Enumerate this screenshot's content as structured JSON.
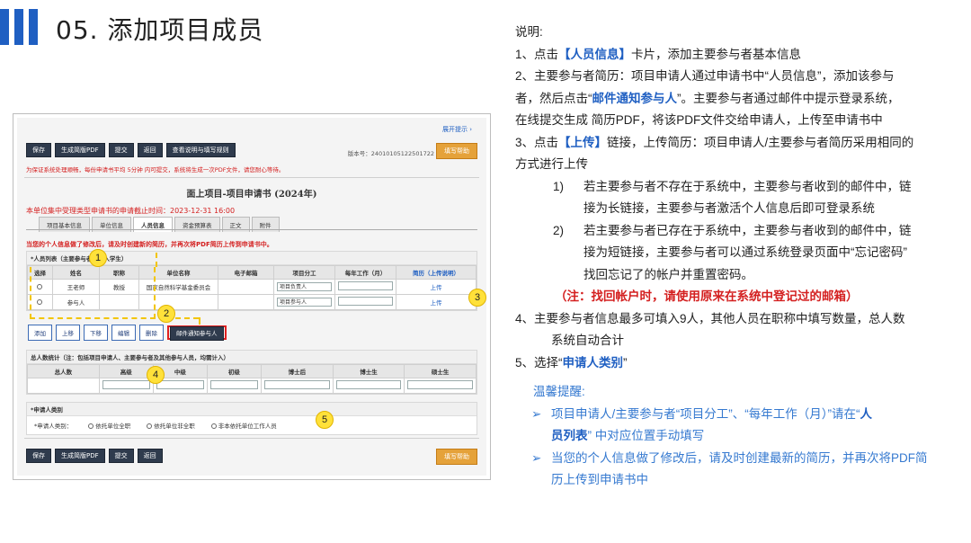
{
  "slide": {
    "number_title": "05. 添加项目成员"
  },
  "screenshot": {
    "top_link": "展开提示 ›",
    "toolbar_buttons": [
      "保存",
      "生成简版PDF",
      "提交",
      "返回",
      "查看说明与填写规则"
    ],
    "help_button": "填写帮助",
    "serial": "版本号：24010105122501722",
    "tip": "为保证系统处理顺畅，每份申请书平均 5分钟 内可提交，系统将生成一次PDF文件，请您耐心等待。",
    "form_title": "面上项目-项目申请书 (2024年)",
    "deadline": "本单位集中受理类型申请书的申请截止时间：2023-12-31 16:00",
    "tabs": [
      "项目基本信息",
      "单位信息",
      "人员信息",
      "资金预算表",
      "正文",
      "附件"
    ],
    "active_tab": "人员信息",
    "warn": "当您的个人信息做了修改后，请及时创建新的简历，并再次将PDF简历上传到申请书中。",
    "person_list_head": "*人员列表（主要参与者须列入学生）",
    "person_cols": [
      "选择",
      "姓名",
      "职称",
      "单位名称",
      "电子邮箱",
      "项目分工",
      "每年工作（月）",
      "简历（上传说明）"
    ],
    "person_rows": [
      {
        "name": "王老师",
        "title": "教授",
        "unit": "国家自然科学基金委员会",
        "email": "",
        "role": "项目负责人",
        "months": "",
        "cv": "上传"
      },
      {
        "name": "参与人",
        "title": "",
        "unit": "",
        "email": "",
        "role": "项目参与人",
        "months": "",
        "cv": "上传"
      }
    ],
    "action_buttons": [
      "添加",
      "上移",
      "下移",
      "编辑",
      "删除"
    ],
    "mail_button": "邮件通知参与人",
    "stats_head": "总人数统计（注：包括项目申请人、主要参与者及其他参与人员，均需计入）",
    "stats_cols": [
      "总人数",
      "高级",
      "中级",
      "初级",
      "博士后",
      "博士生",
      "硕士生"
    ],
    "category_head": "*申请人类别",
    "category_label": "*申请人类别：",
    "category_options": [
      "依托单位全职",
      "依托单位非全职",
      "非本依托单位工作人员"
    ],
    "bottom_buttons": [
      "保存",
      "生成简版PDF",
      "提交",
      "返回"
    ]
  },
  "markers": [
    "1",
    "2",
    "3",
    "4",
    "5"
  ],
  "notes": {
    "heading": "说明:",
    "l1_a": "1、点击",
    "l1_b": "【人员信息】",
    "l1_c": "卡片，添加主要参与者基本信息",
    "l2a": "2、主要参与者简历：项目申请人通过申请书中“人员信息”，添加该参与",
    "l2b_a": "者，然后点击“",
    "l2b_b": "邮件通知参与人",
    "l2b_c": "”。主要参与者通过邮件中提示登录系统，",
    "l2c": "在线提交生成 简历PDF，将该PDF文件交给申请人，上传至申请书中",
    "l3a_a": "3、点击",
    "l3a_b": "【上传】",
    "l3a_c": "链接，上传简历：项目申请人/主要参与者简历采用相同的",
    "l3b": "方式进行上传",
    "s1_num": "1)",
    "s1a": "若主要参与者不存在于系统中，主要参与者收到的邮件中，链",
    "s1b": "接为长链接，主要参与者激活个人信息后即可登录系统",
    "s2_num": "2)",
    "s2a": "若主要参与者已存在于系统中，主要参与者收到的邮件中，链",
    "s2b": "接为短链接，主要参与者可以通过系统登录页面中“忘记密码”",
    "s2c": "找回忘记了的帐户并重置密码。",
    "red_note": "（注：找回帐户时，请使用原来在系统中登记过的邮箱）",
    "l4a": "4、主要参与者信息最多可填入9人，其他人员在职称中填写数量，总人数",
    "l4b": "系统自动合计",
    "l5_a": "5、选择“",
    "l5_b": "申请人类别",
    "l5_c": "”",
    "reminder_title": "温馨提醒:",
    "arrow": "➢",
    "t1a_a": "项目申请人/主要参与者“项目分工”、“每年工作（月）”请在“",
    "t1a_b": "人",
    "t1b_a": "员列表",
    "t1b_b": "” 中对应位置手动填写",
    "t2a": "当您的个人信息做了修改后，请及时创建最新的简历，并再次将PDF简",
    "t2b": "历上传到申请书中"
  },
  "colors": {
    "accent": "#1f5fc2",
    "warning": "#d42020",
    "marker": "#ffe13a",
    "reminder": "#3579d0"
  }
}
